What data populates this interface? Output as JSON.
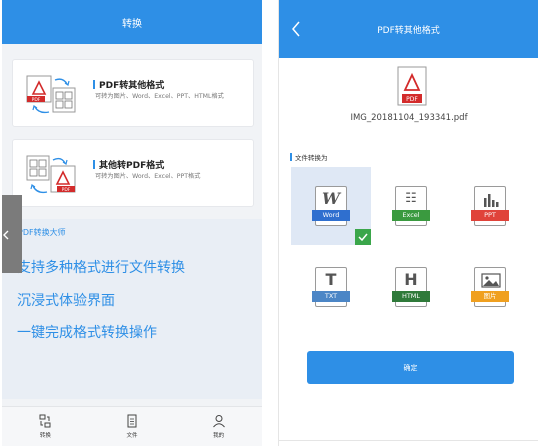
{
  "left": {
    "title": "转换",
    "cards": [
      {
        "title": "PDF转其他格式",
        "subtitle": "可转为图片、Word、Excel、PPT、HTML格式"
      },
      {
        "title": "其他转PDF格式",
        "subtitle": "可转为图片、Word、Excel、PPT格式"
      }
    ],
    "promo": {
      "header": "PDF转换大师",
      "lines": [
        "支持多种格式进行文件转换",
        "沉浸式体验界面",
        "一键完成格式转换操作"
      ]
    },
    "nav": [
      {
        "label": "转换",
        "icon": "convert-icon"
      },
      {
        "label": "文件",
        "icon": "file-icon"
      },
      {
        "label": "我的",
        "icon": "user-icon"
      }
    ]
  },
  "right": {
    "title": "PDF转其他格式",
    "file": {
      "name": "IMG_20181104_193341.pdf",
      "badge": "PDF"
    },
    "section_label": "文件转换为",
    "formats": [
      {
        "glyph": "W",
        "label": "Word",
        "color": "#2f6fcf",
        "selected": true
      },
      {
        "glyph": "☷",
        "label": "Excel",
        "color": "#3a9a3f",
        "selected": false
      },
      {
        "glyph": "▮",
        "label": "PPT",
        "color": "#e0433a",
        "selected": false
      },
      {
        "glyph": "T",
        "label": "TXT",
        "color": "#4c86c6",
        "selected": false
      },
      {
        "glyph": "H",
        "label": "HTML",
        "color": "#2f7a3a",
        "selected": false
      },
      {
        "glyph": "▣",
        "label": "图片",
        "color": "#f0a020",
        "selected": false
      }
    ],
    "confirm_label": "确定"
  },
  "colors": {
    "accent": "#2e8fe6",
    "selected_bg": "#dfe8f5",
    "check": "#3aa64a"
  }
}
